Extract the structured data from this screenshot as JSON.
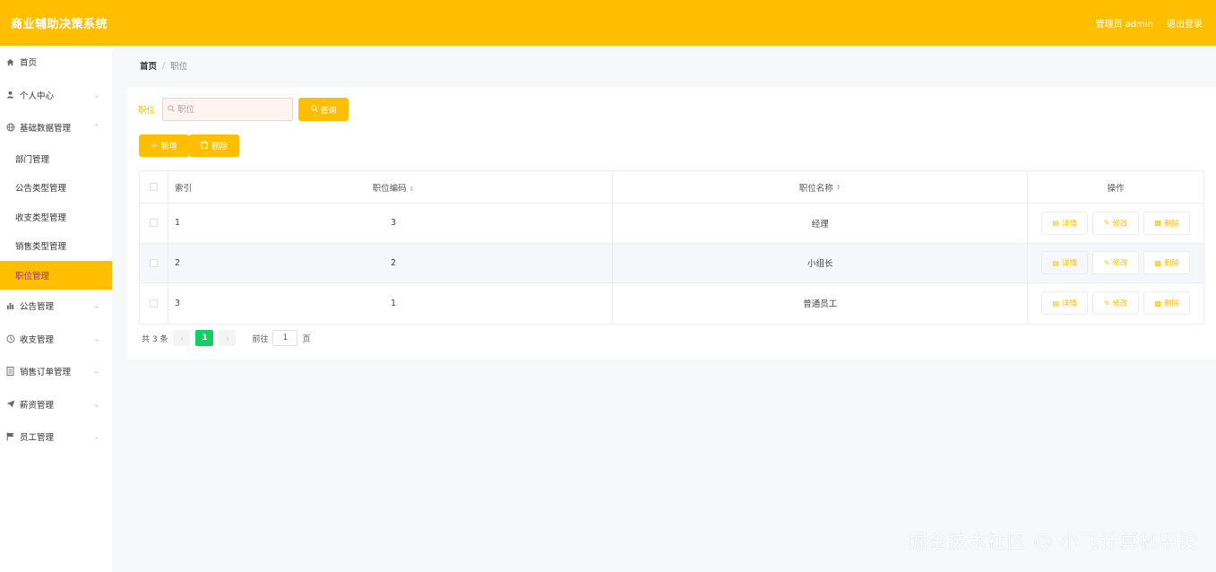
{
  "header": {
    "title": "商业辅助决策系统",
    "user": "管理员 admin",
    "logout": "退出登录"
  },
  "sidebar": {
    "home": "首页",
    "profile": "个人中心",
    "basic": "基础数据管理",
    "sub": [
      "部门管理",
      "公告类型管理",
      "收支类型管理",
      "销售类型管理",
      "职位管理"
    ],
    "notice": "公告管理",
    "finance": "收支管理",
    "sales": "销售订单管理",
    "salary": "薪资管理",
    "staff": "员工管理"
  },
  "breadcrumb": {
    "home": "首页",
    "sep": "/",
    "current": "职位"
  },
  "search": {
    "label": "职位",
    "placeholder": "职位",
    "button": "查询"
  },
  "actions": {
    "add": "新增",
    "delete": "删除"
  },
  "table": {
    "headers": {
      "index": "索引",
      "code": "职位编码",
      "name": "职位名称",
      "ops": "操作"
    },
    "rows": [
      {
        "index": "1",
        "code": "3",
        "name": "经理"
      },
      {
        "index": "2",
        "code": "2",
        "name": "小组长"
      },
      {
        "index": "3",
        "code": "1",
        "name": "普通员工"
      }
    ],
    "ops": {
      "detail": "详情",
      "edit": "修改",
      "delete": "删除"
    }
  },
  "pager": {
    "total": "共 3 条",
    "page": "1",
    "goto": "前往",
    "goto_value": "1",
    "unit": "页"
  },
  "watermark": "掘金技术社区 @ 小飞计算机毕设",
  "colors": {
    "accent": "#ffbf00",
    "pager_active": "#13ce66"
  }
}
